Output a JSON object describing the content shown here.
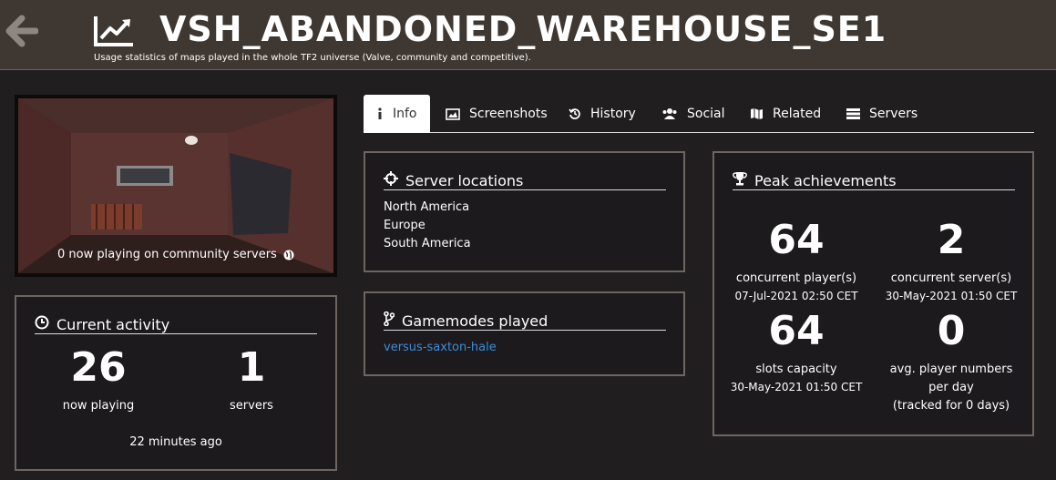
{
  "header": {
    "title": "VSH_ABANDONED_WAREHOUSE_SE1",
    "subtitle": "Usage statistics of maps played in the whole TF2 universe (Valve, community and competitive)."
  },
  "map_image": {
    "caption": "0 now playing on community servers"
  },
  "current_activity": {
    "title": "Current activity",
    "players": "26",
    "players_label": "now playing",
    "servers": "1",
    "servers_label": "servers",
    "updated": "22 minutes ago"
  },
  "tabs": [
    {
      "label": "Info",
      "icon": "info-icon"
    },
    {
      "label": "Screenshots",
      "icon": "image-icon"
    },
    {
      "label": "History",
      "icon": "history-icon"
    },
    {
      "label": "Social",
      "icon": "users-icon"
    },
    {
      "label": "Related",
      "icon": "map-icon"
    },
    {
      "label": "Servers",
      "icon": "server-icon"
    }
  ],
  "server_locations": {
    "title": "Server locations",
    "items": [
      "North America",
      "Europe",
      "South America"
    ]
  },
  "gamemodes": {
    "title": "Gamemodes played",
    "items": [
      "versus-saxton-hale"
    ]
  },
  "peak": {
    "title": "Peak achievements",
    "concurrent_players": "64",
    "concurrent_players_label": "concurrent player(s)",
    "concurrent_players_date": "07-Jul-2021 02:50 CET",
    "concurrent_servers": "2",
    "concurrent_servers_label": "concurrent server(s)",
    "concurrent_servers_date": "30-May-2021 01:50 CET",
    "slots": "64",
    "slots_label": "slots capacity",
    "slots_date": "30-May-2021 01:50 CET",
    "avg_players": "0",
    "avg_players_label_1": "avg. player numbers",
    "avg_players_label_2": "per day",
    "avg_players_label_3": "(tracked for 0 days)"
  }
}
